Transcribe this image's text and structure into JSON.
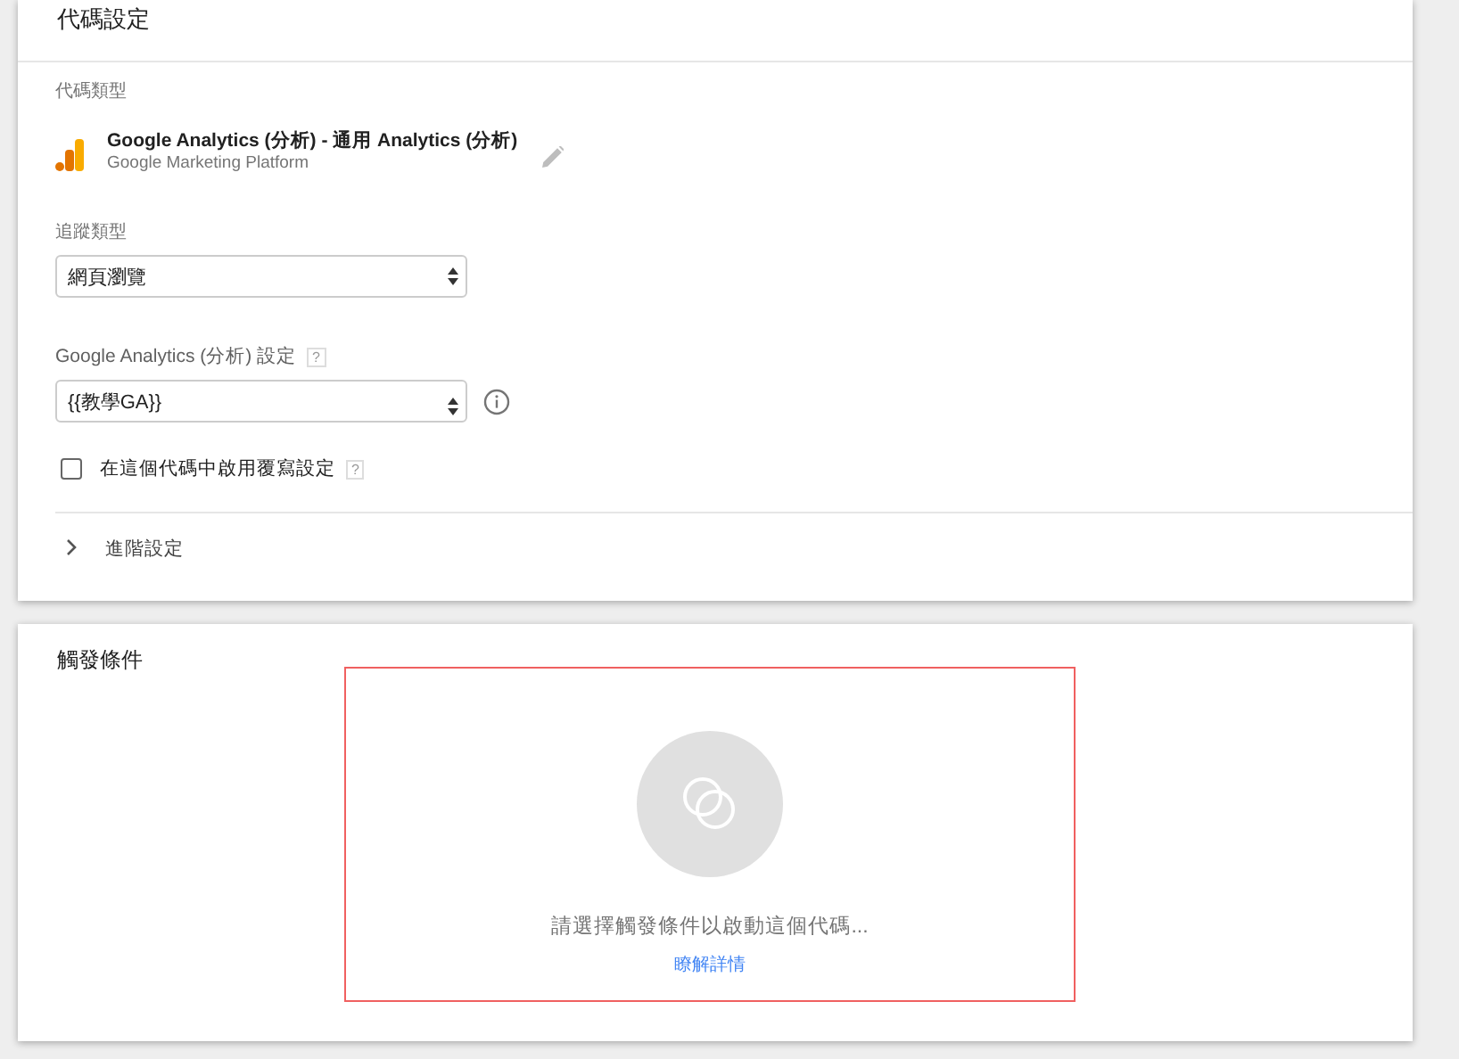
{
  "config_card": {
    "title": "代碼設定",
    "tag_type_label": "代碼類型",
    "tag_type": {
      "name": "Google Analytics (分析) - 通用 Analytics (分析)",
      "vendor": "Google Marketing Platform"
    },
    "track_type": {
      "label": "追蹤類型",
      "value": "網頁瀏覽"
    },
    "ga_settings": {
      "label": "Google Analytics (分析) 設定",
      "help": "?",
      "value": "{{教學GA}}"
    },
    "override": {
      "label": "在這個代碼中啟用覆寫設定",
      "help": "?",
      "checked": false
    },
    "advanced": {
      "label": "進階設定",
      "expanded": false
    }
  },
  "triggers_card": {
    "title": "觸發條件",
    "prompt": "請選擇觸發條件以啟動這個代碼...",
    "link": "瞭解詳情"
  }
}
